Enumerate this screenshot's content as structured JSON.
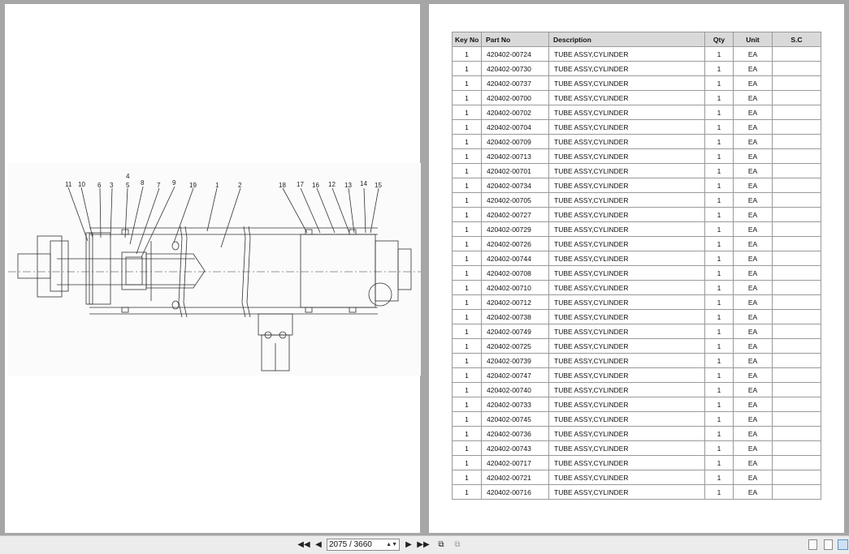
{
  "drawing": {
    "callouts": [
      "11",
      "10",
      "6",
      "3",
      "4",
      "5",
      "8",
      "7",
      "9",
      "19",
      "1",
      "2",
      "18",
      "17",
      "16",
      "12",
      "13",
      "14",
      "15"
    ]
  },
  "table": {
    "headers": [
      "Key No",
      "Part No",
      "Description",
      "Qty",
      "Unit",
      "S.C"
    ],
    "rows": [
      [
        "1",
        "420402-00724",
        "TUBE ASSY,CYLINDER",
        "1",
        "EA",
        ""
      ],
      [
        "1",
        "420402-00730",
        "TUBE ASSY,CYLINDER",
        "1",
        "EA",
        ""
      ],
      [
        "1",
        "420402-00737",
        "TUBE ASSY,CYLINDER",
        "1",
        "EA",
        ""
      ],
      [
        "1",
        "420402-00700",
        "TUBE ASSY,CYLINDER",
        "1",
        "EA",
        ""
      ],
      [
        "1",
        "420402-00702",
        "TUBE ASSY,CYLINDER",
        "1",
        "EA",
        ""
      ],
      [
        "1",
        "420402-00704",
        "TUBE ASSY,CYLINDER",
        "1",
        "EA",
        ""
      ],
      [
        "1",
        "420402-00709",
        "TUBE ASSY,CYLINDER",
        "1",
        "EA",
        ""
      ],
      [
        "1",
        "420402-00713",
        "TUBE ASSY,CYLINDER",
        "1",
        "EA",
        ""
      ],
      [
        "1",
        "420402-00701",
        "TUBE ASSY,CYLINDER",
        "1",
        "EA",
        ""
      ],
      [
        "1",
        "420402-00734",
        "TUBE ASSY,CYLINDER",
        "1",
        "EA",
        ""
      ],
      [
        "1",
        "420402-00705",
        "TUBE ASSY,CYLINDER",
        "1",
        "EA",
        ""
      ],
      [
        "1",
        "420402-00727",
        "TUBE ASSY,CYLINDER",
        "1",
        "EA",
        ""
      ],
      [
        "1",
        "420402-00729",
        "TUBE ASSY,CYLINDER",
        "1",
        "EA",
        ""
      ],
      [
        "1",
        "420402-00726",
        "TUBE ASSY,CYLINDER",
        "1",
        "EA",
        ""
      ],
      [
        "1",
        "420402-00744",
        "TUBE ASSY,CYLINDER",
        "1",
        "EA",
        ""
      ],
      [
        "1",
        "420402-00708",
        "TUBE ASSY,CYLINDER",
        "1",
        "EA",
        ""
      ],
      [
        "1",
        "420402-00710",
        "TUBE ASSY,CYLINDER",
        "1",
        "EA",
        ""
      ],
      [
        "1",
        "420402-00712",
        "TUBE ASSY,CYLINDER",
        "1",
        "EA",
        ""
      ],
      [
        "1",
        "420402-00738",
        "TUBE ASSY,CYLINDER",
        "1",
        "EA",
        ""
      ],
      [
        "1",
        "420402-00749",
        "TUBE ASSY,CYLINDER",
        "1",
        "EA",
        ""
      ],
      [
        "1",
        "420402-00725",
        "TUBE ASSY,CYLINDER",
        "1",
        "EA",
        ""
      ],
      [
        "1",
        "420402-00739",
        "TUBE ASSY,CYLINDER",
        "1",
        "EA",
        ""
      ],
      [
        "1",
        "420402-00747",
        "TUBE ASSY,CYLINDER",
        "1",
        "EA",
        ""
      ],
      [
        "1",
        "420402-00740",
        "TUBE ASSY,CYLINDER",
        "1",
        "EA",
        ""
      ],
      [
        "1",
        "420402-00733",
        "TUBE ASSY,CYLINDER",
        "1",
        "EA",
        ""
      ],
      [
        "1",
        "420402-00745",
        "TUBE ASSY,CYLINDER",
        "1",
        "EA",
        ""
      ],
      [
        "1",
        "420402-00736",
        "TUBE ASSY,CYLINDER",
        "1",
        "EA",
        ""
      ],
      [
        "1",
        "420402-00743",
        "TUBE ASSY,CYLINDER",
        "1",
        "EA",
        ""
      ],
      [
        "1",
        "420402-00717",
        "TUBE ASSY,CYLINDER",
        "1",
        "EA",
        ""
      ],
      [
        "1",
        "420402-00721",
        "TUBE ASSY,CYLINDER",
        "1",
        "EA",
        ""
      ],
      [
        "1",
        "420402-00716",
        "TUBE ASSY,CYLINDER",
        "1",
        "EA",
        ""
      ]
    ]
  },
  "toolbar": {
    "first_icon": "first-page-icon",
    "prev_icon": "previous-page-icon",
    "page_value": "2075 / 3660",
    "next_icon": "next-page-icon",
    "last_icon": "last-page-icon",
    "go_back_icon": "go-back-view-icon",
    "go_forward_icon": "go-forward-view-icon",
    "view_modes": [
      "single-page-view-icon",
      "continuous-view-icon",
      "facing-pages-view-icon"
    ],
    "active_view_mode": "facing-pages-view-icon"
  }
}
